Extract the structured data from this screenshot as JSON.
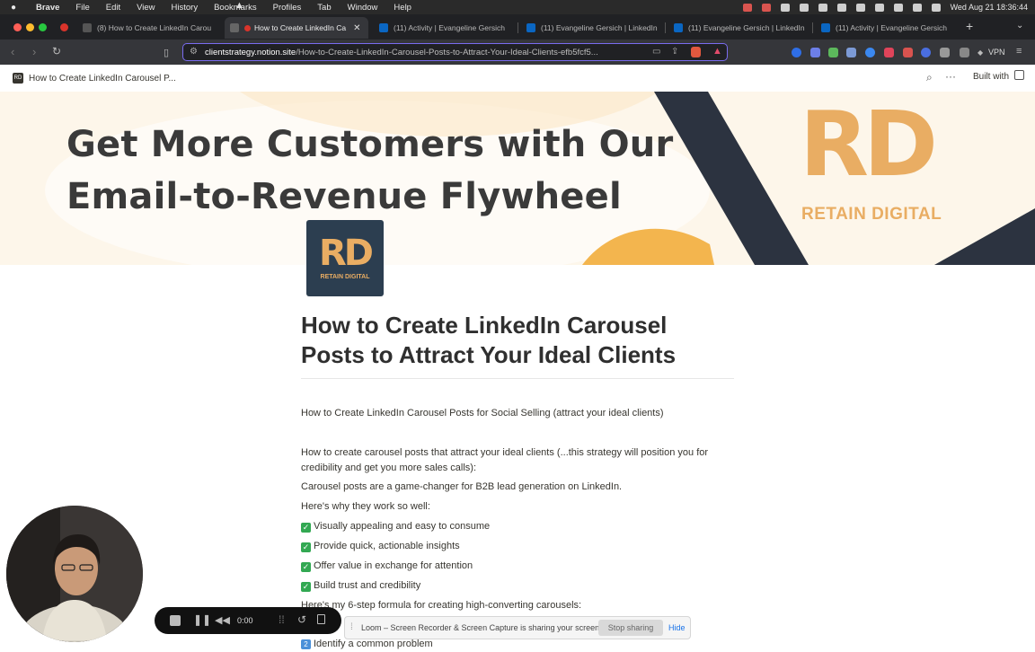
{
  "menubar": {
    "app_name": "Brave",
    "items": [
      "File",
      "Edit",
      "View",
      "History",
      "Bookmarks",
      "Profiles",
      "Tab",
      "Window",
      "Help"
    ],
    "clock": "Wed Aug 21  18:36:44"
  },
  "tabs": [
    {
      "label": "(8) How to Create LinkedIn Carou",
      "active": false
    },
    {
      "label": "How to Create LinkedIn Ca",
      "active": true
    },
    {
      "label": "(11) Activity | Evangeline Gersich",
      "active": false
    },
    {
      "label": "(11) Evangeline Gersich | LinkedIn",
      "active": false
    },
    {
      "label": "(11) Evangeline Gersich | LinkedIn",
      "active": false
    },
    {
      "label": "(11) Activity | Evangeline Gersich",
      "active": false
    }
  ],
  "urlbar": {
    "host": "clientstrategy.notion.site",
    "path": "/How-to-Create-LinkedIn-Carousel-Posts-to-Attract-Your-Ideal-Clients-efb5fcf5..."
  },
  "vpn_label": "VPN",
  "notion": {
    "breadcrumb_badge": "RD",
    "breadcrumb": "How to Create LinkedIn Carousel P...",
    "built_with": "Built with"
  },
  "banner": {
    "headline_line1": "Get More Customers with Our",
    "headline_line2": "Email-to-Revenue Flywheel",
    "logo_text": "RD",
    "logo_sub": "RETAIN DIGITAL"
  },
  "page_icon": {
    "text": "RD",
    "sub": "RETAIN DIGITAL"
  },
  "page": {
    "title": "How to Create LinkedIn Carousel Posts to Attract Your Ideal Clients",
    "p1": "How to Create LinkedIn Carousel Posts for Social Selling (attract your ideal clients)",
    "p2": "How to create carousel posts that attract your ideal clients (...this strategy will position you for credibility and get you more sales calls):",
    "p3": "Carousel posts are a game-changer for B2B lead generation on LinkedIn.",
    "p4": "Here's why they work so well:",
    "checks": [
      "Visually appealing and easy to consume",
      "Provide quick, actionable insights",
      "Offer value in exchange for attention",
      "Build trust and credibility"
    ],
    "p5": "Here's my 6-step formula for creating high-converting carousels:",
    "step2": "Identify a common problem",
    "step2_badge": "2"
  },
  "loom": {
    "timer": "0:00",
    "share_msg": "Loom – Screen Recorder & Screen Capture is sharing your screen.",
    "stop_label": "Stop sharing",
    "hide_label": "Hide"
  },
  "colors": {
    "accent": "#7a6cf0",
    "brand_orange": "#e9ad63",
    "brand_navy": "#2c3e50",
    "check_green": "#32a852"
  }
}
